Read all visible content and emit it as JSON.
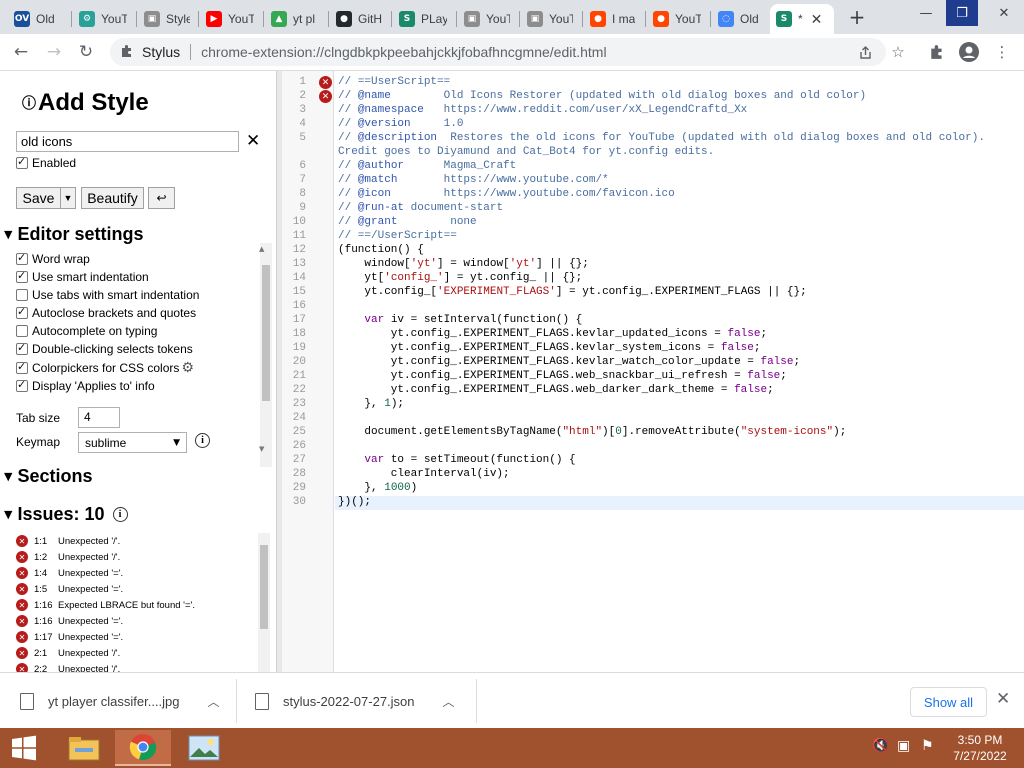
{
  "browser": {
    "tabs": [
      {
        "title": "Old",
        "icon": "ov-icon",
        "color": "#1a4f9c",
        "glyph": "OV"
      },
      {
        "title": "YouT",
        "icon": "gear-globe-icon",
        "color": "#2aa198",
        "glyph": "⚙"
      },
      {
        "title": "Style",
        "icon": "stylus-folder-icon",
        "color": "#8d8d8d",
        "glyph": "▣"
      },
      {
        "title": "YouT",
        "icon": "youtube-icon",
        "color": "#ff0000",
        "glyph": "▶"
      },
      {
        "title": "yt pl",
        "icon": "google-drive-icon",
        "color": "#34a853",
        "glyph": "▲"
      },
      {
        "title": "GitH",
        "icon": "github-icon",
        "color": "#24292e",
        "glyph": "●"
      },
      {
        "title": "PLay",
        "icon": "stylus-icon",
        "color": "#1b8a6b",
        "glyph": "S"
      },
      {
        "title": "YouT",
        "icon": "folder-icon",
        "color": "#8d8d8d",
        "glyph": "▣"
      },
      {
        "title": "YouT",
        "icon": "folder-icon",
        "color": "#8d8d8d",
        "glyph": "▣"
      },
      {
        "title": "I ma",
        "icon": "reddit-icon",
        "color": "#ff4500",
        "glyph": "●"
      },
      {
        "title": "YouT",
        "icon": "reddit-icon",
        "color": "#ff4500",
        "glyph": "●"
      },
      {
        "title": "Old",
        "icon": "loading-icon",
        "color": "#4285f4",
        "glyph": "◌"
      },
      {
        "title": "*",
        "icon": "stylus-icon",
        "color": "#1b8a6b",
        "glyph": "S"
      }
    ],
    "close_glyph": "✕",
    "new_tab_glyph": "+",
    "window_controls": {
      "minimize": "—",
      "maximize": "❐",
      "close": "✕"
    },
    "address": {
      "site_name": "Stylus",
      "url": "chrome-extension://clngdbkpkpeebahjckkjfobafhncgmne/edit.html"
    },
    "nav": {
      "back": "←",
      "forward": "→",
      "reload": "↻"
    }
  },
  "sidebar": {
    "title": "Add Style",
    "style_name_value": "old icons",
    "enabled_label": "Enabled",
    "enabled": true,
    "save_label": "Save",
    "beautify_label": "Beautify",
    "undo_glyph": "↩",
    "editor_settings_title": "Editor settings",
    "options": [
      {
        "label": "Word wrap",
        "checked": true
      },
      {
        "label": "Use smart indentation",
        "checked": true
      },
      {
        "label": "Use tabs with smart indentation",
        "checked": false
      },
      {
        "label": "Autoclose brackets and quotes",
        "checked": true
      },
      {
        "label": "Autocomplete on typing",
        "checked": false
      },
      {
        "label": "Double-clicking selects tokens",
        "checked": true
      },
      {
        "label": "Colorpickers for CSS colors",
        "checked": true
      },
      {
        "label": "Display 'Applies to' info",
        "checked": true
      }
    ],
    "tab_size_label": "Tab size",
    "tab_size_value": "4",
    "keymap_label": "Keymap",
    "keymap_value": "sublime",
    "sections_title": "Sections",
    "issues_title": "Issues: 10",
    "issues": [
      {
        "pos": "1:1",
        "msg": "Unexpected '/'."
      },
      {
        "pos": "1:2",
        "msg": "Unexpected '/'."
      },
      {
        "pos": "1:4",
        "msg": "Unexpected '='."
      },
      {
        "pos": "1:5",
        "msg": "Unexpected '='."
      },
      {
        "pos": "1:16",
        "msg": "Expected LBRACE but found '='."
      },
      {
        "pos": "1:16",
        "msg": "Unexpected '='."
      },
      {
        "pos": "1:17",
        "msg": "Unexpected '='."
      },
      {
        "pos": "2:1",
        "msg": "Unexpected '/'."
      },
      {
        "pos": "2:2",
        "msg": "Unexpected '/'."
      }
    ]
  },
  "editor": {
    "line_numbers": [
      "1",
      "2",
      "3",
      "4",
      "5",
      "",
      "6",
      "7",
      "8",
      "9",
      "10",
      "11",
      "12",
      "13",
      "14",
      "15",
      "16",
      "17",
      "18",
      "19",
      "20",
      "21",
      "22",
      "23",
      "24",
      "25",
      "26",
      "27",
      "28",
      "29",
      "30"
    ],
    "lines": [
      [
        [
          "c-comment",
          "// ==UserScript=="
        ]
      ],
      [
        [
          "c-comment",
          "// "
        ],
        [
          "c-meta",
          "@name"
        ],
        [
          "c-comment",
          "        Old Icons Restorer (updated with old dialog boxes and old color)"
        ]
      ],
      [
        [
          "c-comment",
          "// "
        ],
        [
          "c-meta",
          "@namespace"
        ],
        [
          "c-comment",
          "   https://www.reddit.com/user/xX_LegendCraftd_Xx"
        ]
      ],
      [
        [
          "c-comment",
          "// "
        ],
        [
          "c-meta",
          "@version"
        ],
        [
          "c-comment",
          "     1.0"
        ]
      ],
      [
        [
          "c-comment",
          "// "
        ],
        [
          "c-meta",
          "@description"
        ],
        [
          "c-comment",
          "  Restores the old icons for YouTube (updated with old dialog boxes and old color)."
        ]
      ],
      [
        [
          "c-comment",
          "Credit goes to Diyamund and Cat_Bot4 for yt.config edits."
        ]
      ],
      [
        [
          "c-comment",
          "// "
        ],
        [
          "c-meta",
          "@author"
        ],
        [
          "c-comment",
          "      Magma_Craft"
        ]
      ],
      [
        [
          "c-comment",
          "// "
        ],
        [
          "c-meta",
          "@match"
        ],
        [
          "c-comment",
          "       https://www.youtube.com/*"
        ]
      ],
      [
        [
          "c-comment",
          "// "
        ],
        [
          "c-meta",
          "@icon"
        ],
        [
          "c-comment",
          "        https://www.youtube.com/favicon.ico"
        ]
      ],
      [
        [
          "c-comment",
          "// "
        ],
        [
          "c-meta",
          "@run-at"
        ],
        [
          "c-comment",
          " document-start"
        ]
      ],
      [
        [
          "c-comment",
          "// "
        ],
        [
          "c-meta",
          "@grant"
        ],
        [
          "c-comment",
          "        none"
        ]
      ],
      [
        [
          "c-comment",
          "// ==/UserScript=="
        ]
      ],
      [
        [
          "c-plain",
          "(function() {"
        ]
      ],
      [
        [
          "c-plain",
          "    window["
        ],
        [
          "c-str",
          "'yt'"
        ],
        [
          "c-plain",
          "] = window["
        ],
        [
          "c-str",
          "'yt'"
        ],
        [
          "c-plain",
          "] || {};"
        ]
      ],
      [
        [
          "c-plain",
          "    yt["
        ],
        [
          "c-str",
          "'config_'"
        ],
        [
          "c-plain",
          "] = yt.config_ || {};"
        ]
      ],
      [
        [
          "c-plain",
          "    yt.config_["
        ],
        [
          "c-str",
          "'EXPERIMENT_FLAGS'"
        ],
        [
          "c-plain",
          "] = yt.config_.EXPERIMENT_FLAGS || {};"
        ]
      ],
      [
        [
          "c-plain",
          ""
        ]
      ],
      [
        [
          "c-kw",
          "    var"
        ],
        [
          "c-plain",
          " iv = setInterval(function() {"
        ]
      ],
      [
        [
          "c-plain",
          "        yt.config_.EXPERIMENT_FLAGS.kevlar_updated_icons = "
        ],
        [
          "c-kw",
          "false"
        ],
        [
          "c-plain",
          ";"
        ]
      ],
      [
        [
          "c-plain",
          "        yt.config_.EXPERIMENT_FLAGS.kevlar_system_icons = "
        ],
        [
          "c-kw",
          "false"
        ],
        [
          "c-plain",
          ";"
        ]
      ],
      [
        [
          "c-plain",
          "        yt.config_.EXPERIMENT_FLAGS.kevlar_watch_color_update = "
        ],
        [
          "c-kw",
          "false"
        ],
        [
          "c-plain",
          ";"
        ]
      ],
      [
        [
          "c-plain",
          "        yt.config_.EXPERIMENT_FLAGS.web_snackbar_ui_refresh = "
        ],
        [
          "c-kw",
          "false"
        ],
        [
          "c-plain",
          ";"
        ]
      ],
      [
        [
          "c-plain",
          "        yt.config_.EXPERIMENT_FLAGS.web_darker_dark_theme = "
        ],
        [
          "c-kw",
          "false"
        ],
        [
          "c-plain",
          ";"
        ]
      ],
      [
        [
          "c-plain",
          "    }, "
        ],
        [
          "c-num",
          "1"
        ],
        [
          "c-plain",
          ");"
        ]
      ],
      [
        [
          "c-plain",
          ""
        ]
      ],
      [
        [
          "c-plain",
          "    document.getElementsByTagName("
        ],
        [
          "c-str",
          "\"html\""
        ],
        [
          "c-plain",
          ")["
        ],
        [
          "c-num",
          "0"
        ],
        [
          "c-plain",
          "].removeAttribute("
        ],
        [
          "c-str",
          "\"system-icons\""
        ],
        [
          "c-plain",
          ");"
        ]
      ],
      [
        [
          "c-plain",
          ""
        ]
      ],
      [
        [
          "c-kw",
          "    var"
        ],
        [
          "c-plain",
          " to = setTimeout(function() {"
        ]
      ],
      [
        [
          "c-plain",
          "        clearInterval(iv);"
        ]
      ],
      [
        [
          "c-plain",
          "    }, "
        ],
        [
          "c-num",
          "1000"
        ],
        [
          "c-plain",
          ")"
        ]
      ],
      [
        [
          "c-plain",
          "})();"
        ]
      ]
    ]
  },
  "downloads": {
    "items": [
      {
        "name": "yt player classifer....jpg"
      },
      {
        "name": "stylus-2022-07-27.json"
      }
    ],
    "show_all_label": "Show all",
    "close_glyph": "✕"
  },
  "taskbar": {
    "time": "3:50 PM",
    "date": "7/27/2022"
  },
  "colors": {
    "accent": "#1a73e8",
    "error": "#b71c1c",
    "taskbar": "#a0512e"
  }
}
